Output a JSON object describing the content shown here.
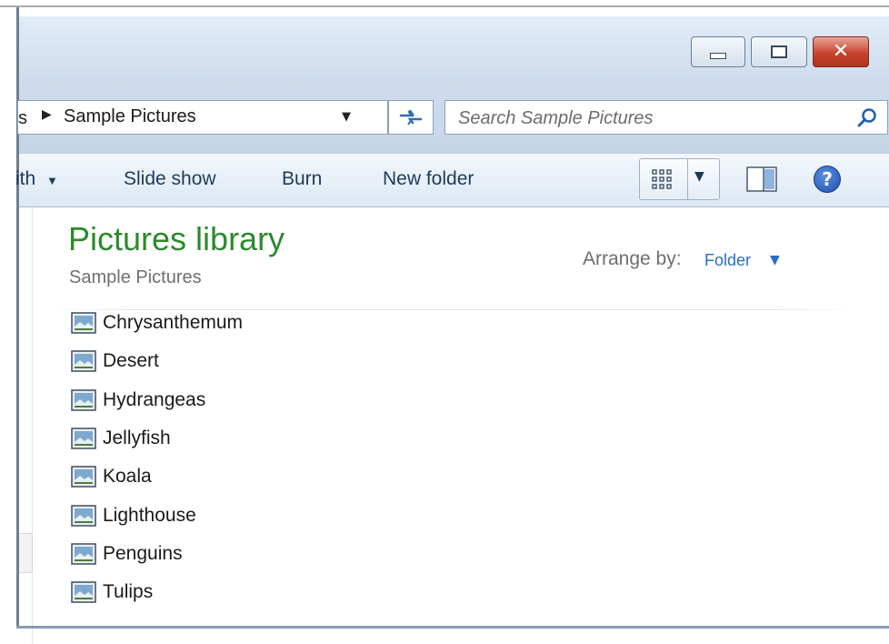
{
  "address_bar": {
    "breadcrumb_fragment": "s",
    "current_folder": "Sample Pictures"
  },
  "search": {
    "placeholder": "Search Sample Pictures"
  },
  "command_bar": {
    "share_with_fragment": "ith",
    "items": [
      "Slide show",
      "Burn",
      "New folder"
    ]
  },
  "library": {
    "title": "Pictures library",
    "subtitle": "Sample Pictures",
    "arrange_by_label": "Arrange by:",
    "arrange_by_value": "Folder"
  },
  "files": [
    "Chrysanthemum",
    "Desert",
    "Hydrangeas",
    "Jellyfish",
    "Koala",
    "Lighthouse",
    "Penguins",
    "Tulips"
  ],
  "icons": {
    "minimize": "minimize-icon",
    "maximize": "maximize-icon",
    "close": "close-icon",
    "refresh": "refresh-icon",
    "search": "search-icon",
    "views": "views-icon",
    "preview_pane": "preview-pane-icon",
    "help": "help-icon",
    "file": "image-file-icon"
  },
  "colors": {
    "library_title": "#2b8a2b",
    "arrange_value": "#2a6fc1",
    "command_text": "#1e395b",
    "close_button": "#c8432d"
  }
}
